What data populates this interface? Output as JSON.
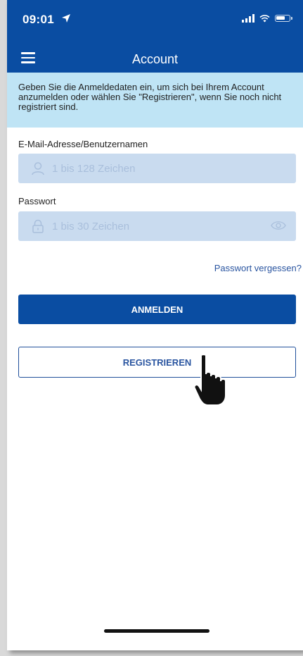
{
  "status_bar": {
    "time": "09:01",
    "icons": [
      "location-arrow-icon",
      "cellular-signal-icon",
      "wifi-icon",
      "battery-icon"
    ]
  },
  "header": {
    "title": "Account",
    "menu_icon": "hamburger-menu-icon",
    "color": "#0a4da2"
  },
  "info": {
    "text": "Geben Sie die Anmeldedaten ein, um sich bei Ihrem Account anzumelden oder wählen Sie \"Registrieren\", wenn Sie noch nicht registriert sind.",
    "background": "#bfe4f5"
  },
  "form": {
    "username": {
      "label": "E-Mail-Adresse/Benutzernamen",
      "placeholder": "1 bis 128 Zeichen",
      "icon": "user-icon"
    },
    "password": {
      "label": "Passwort",
      "placeholder": "1 bis 30 Zeichen",
      "icon": "lock-icon",
      "toggle_icon": "eye-icon"
    },
    "forgot_link": "Passwort vergessen?",
    "login_button": "ANMELDEN",
    "register_button": "REGISTRIEREN"
  },
  "overlay": {
    "pointer_icon": "hand-pointer-icon"
  }
}
